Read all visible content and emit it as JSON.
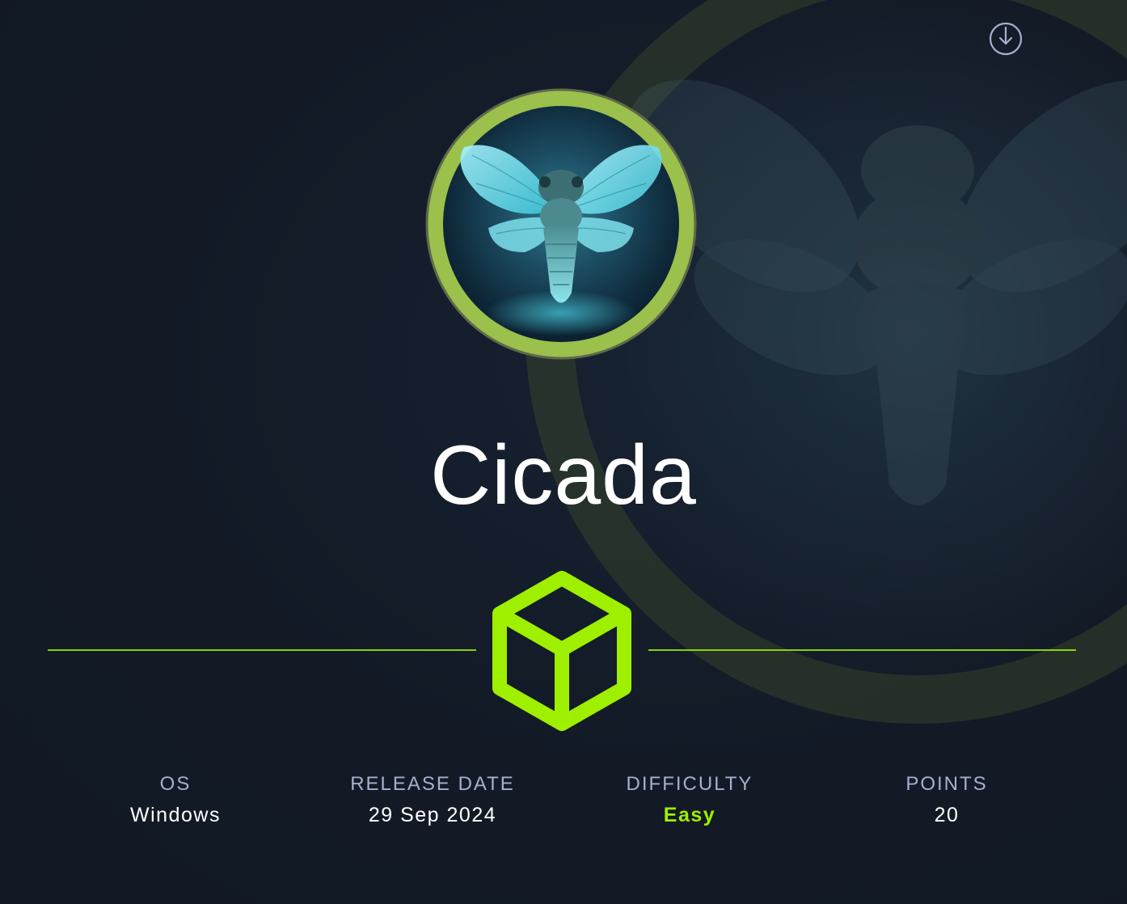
{
  "machine": {
    "name": "Cicada"
  },
  "stats": [
    {
      "label": "OS",
      "value": "Windows"
    },
    {
      "label": "RELEASE DATE",
      "value": "29 Sep 2024"
    },
    {
      "label": "DIFFICULTY",
      "value": "Easy"
    },
    {
      "label": "POINTS",
      "value": "20"
    }
  ],
  "icons": {
    "download": "download-circle-icon",
    "cube": "cube-icon",
    "avatar": "cicada-avatar"
  },
  "colors": {
    "background": "#141b27",
    "accent_green": "#9fef00",
    "ring_green": "#9bc04b",
    "label_gray": "#a4b1cd",
    "text_white": "#ffffff"
  }
}
